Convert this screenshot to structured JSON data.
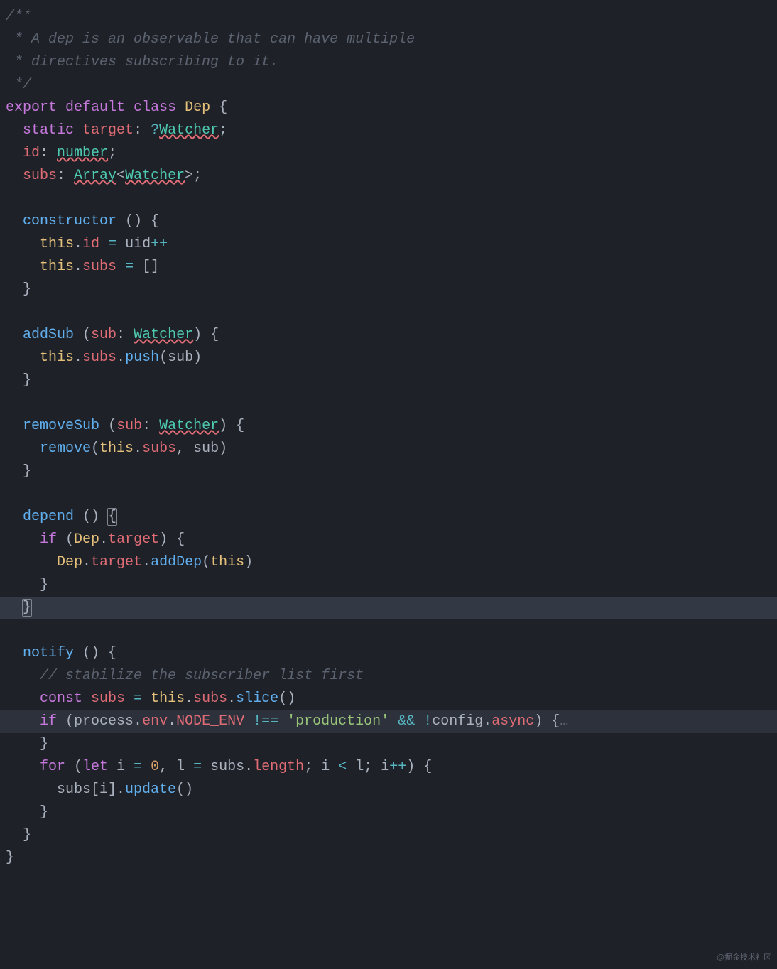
{
  "watermark": "@掘金技术社区",
  "code": {
    "lines": [
      [
        {
          "c": "cm",
          "t": "/**"
        }
      ],
      [
        {
          "c": "cm",
          "t": " * A dep is an observable that can have multiple"
        }
      ],
      [
        {
          "c": "cm",
          "t": " * directives subscribing to it."
        }
      ],
      [
        {
          "c": "cm",
          "t": " */"
        }
      ],
      [
        {
          "c": "kw",
          "t": "export"
        },
        {
          "c": "pn",
          "t": " "
        },
        {
          "c": "kw",
          "t": "default"
        },
        {
          "c": "pn",
          "t": " "
        },
        {
          "c": "kw",
          "t": "class"
        },
        {
          "c": "pn",
          "t": " "
        },
        {
          "c": "cls",
          "t": "Dep"
        },
        {
          "c": "pn",
          "t": " {"
        }
      ],
      [
        {
          "c": "pn",
          "t": "  "
        },
        {
          "c": "kw",
          "t": "static"
        },
        {
          "c": "pn",
          "t": " "
        },
        {
          "c": "var",
          "t": "target"
        },
        {
          "c": "pn",
          "t": ": "
        },
        {
          "c": "op",
          "t": "?"
        },
        {
          "c": "type err",
          "t": "Watcher"
        },
        {
          "c": "pn",
          "t": ";"
        }
      ],
      [
        {
          "c": "pn",
          "t": "  "
        },
        {
          "c": "var",
          "t": "id"
        },
        {
          "c": "pn",
          "t": ": "
        },
        {
          "c": "type err",
          "t": "number"
        },
        {
          "c": "pn",
          "t": ";"
        }
      ],
      [
        {
          "c": "pn",
          "t": "  "
        },
        {
          "c": "var",
          "t": "subs"
        },
        {
          "c": "pn",
          "t": ": "
        },
        {
          "c": "type err",
          "t": "Array"
        },
        {
          "c": "pn",
          "t": "<"
        },
        {
          "c": "type err",
          "t": "Watcher"
        },
        {
          "c": "pn",
          "t": ">;"
        }
      ],
      [
        {
          "c": "pn",
          "t": ""
        }
      ],
      [
        {
          "c": "pn",
          "t": "  "
        },
        {
          "c": "fn",
          "t": "constructor"
        },
        {
          "c": "pn",
          "t": " () {"
        }
      ],
      [
        {
          "c": "pn",
          "t": "    "
        },
        {
          "c": "th",
          "t": "this"
        },
        {
          "c": "pn",
          "t": "."
        },
        {
          "c": "var",
          "t": "id"
        },
        {
          "c": "pn",
          "t": " "
        },
        {
          "c": "op",
          "t": "="
        },
        {
          "c": "pn",
          "t": " uid"
        },
        {
          "c": "op",
          "t": "++"
        }
      ],
      [
        {
          "c": "pn",
          "t": "    "
        },
        {
          "c": "th",
          "t": "this"
        },
        {
          "c": "pn",
          "t": "."
        },
        {
          "c": "var",
          "t": "subs"
        },
        {
          "c": "pn",
          "t": " "
        },
        {
          "c": "op",
          "t": "="
        },
        {
          "c": "pn",
          "t": " []"
        }
      ],
      [
        {
          "c": "pn",
          "t": "  }"
        }
      ],
      [
        {
          "c": "pn",
          "t": ""
        }
      ],
      [
        {
          "c": "pn",
          "t": "  "
        },
        {
          "c": "fn",
          "t": "addSub"
        },
        {
          "c": "pn",
          "t": " ("
        },
        {
          "c": "var",
          "t": "sub"
        },
        {
          "c": "pn",
          "t": ": "
        },
        {
          "c": "type err",
          "t": "Watcher"
        },
        {
          "c": "pn",
          "t": ") {"
        }
      ],
      [
        {
          "c": "pn",
          "t": "    "
        },
        {
          "c": "th",
          "t": "this"
        },
        {
          "c": "pn",
          "t": "."
        },
        {
          "c": "var",
          "t": "subs"
        },
        {
          "c": "pn",
          "t": "."
        },
        {
          "c": "fn",
          "t": "push"
        },
        {
          "c": "pn",
          "t": "(sub)"
        }
      ],
      [
        {
          "c": "pn",
          "t": "  }"
        }
      ],
      [
        {
          "c": "pn",
          "t": ""
        }
      ],
      [
        {
          "c": "pn",
          "t": "  "
        },
        {
          "c": "fn",
          "t": "removeSub"
        },
        {
          "c": "pn",
          "t": " ("
        },
        {
          "c": "var",
          "t": "sub"
        },
        {
          "c": "pn",
          "t": ": "
        },
        {
          "c": "type err",
          "t": "Watcher"
        },
        {
          "c": "pn",
          "t": ") {"
        }
      ],
      [
        {
          "c": "pn",
          "t": "    "
        },
        {
          "c": "fn",
          "t": "remove"
        },
        {
          "c": "pn",
          "t": "("
        },
        {
          "c": "th",
          "t": "this"
        },
        {
          "c": "pn",
          "t": "."
        },
        {
          "c": "var",
          "t": "subs"
        },
        {
          "c": "pn",
          "t": ", sub)"
        }
      ],
      [
        {
          "c": "pn",
          "t": "  }"
        }
      ],
      [
        {
          "c": "pn",
          "t": ""
        }
      ],
      [
        {
          "c": "pn",
          "t": "  "
        },
        {
          "c": "fn",
          "t": "depend"
        },
        {
          "c": "pn",
          "t": " () "
        },
        {
          "c": "pn bracket-highlight",
          "t": "{"
        }
      ],
      [
        {
          "c": "pn",
          "t": "    "
        },
        {
          "c": "kw",
          "t": "if"
        },
        {
          "c": "pn",
          "t": " ("
        },
        {
          "c": "cls",
          "t": "Dep"
        },
        {
          "c": "pn",
          "t": "."
        },
        {
          "c": "var",
          "t": "target"
        },
        {
          "c": "pn",
          "t": ") {"
        }
      ],
      [
        {
          "c": "pn",
          "t": "      "
        },
        {
          "c": "cls",
          "t": "Dep"
        },
        {
          "c": "pn",
          "t": "."
        },
        {
          "c": "var",
          "t": "target"
        },
        {
          "c": "pn",
          "t": "."
        },
        {
          "c": "fn",
          "t": "addDep"
        },
        {
          "c": "pn",
          "t": "("
        },
        {
          "c": "th",
          "t": "this"
        },
        {
          "c": "pn",
          "t": ")"
        }
      ],
      [
        {
          "c": "pn",
          "t": "    }"
        }
      ],
      [
        {
          "c": "pn",
          "t": "  "
        },
        {
          "c": "pn bracket-highlight",
          "t": "}"
        }
      ],
      [
        {
          "c": "pn",
          "t": ""
        }
      ],
      [
        {
          "c": "pn",
          "t": "  "
        },
        {
          "c": "fn",
          "t": "notify"
        },
        {
          "c": "pn",
          "t": " () {"
        }
      ],
      [
        {
          "c": "pn",
          "t": "    "
        },
        {
          "c": "cm",
          "t": "// stabilize the subscriber list first"
        }
      ],
      [
        {
          "c": "pn",
          "t": "    "
        },
        {
          "c": "kw",
          "t": "const"
        },
        {
          "c": "pn",
          "t": " "
        },
        {
          "c": "var",
          "t": "subs"
        },
        {
          "c": "pn",
          "t": " "
        },
        {
          "c": "op",
          "t": "="
        },
        {
          "c": "pn",
          "t": " "
        },
        {
          "c": "th",
          "t": "this"
        },
        {
          "c": "pn",
          "t": "."
        },
        {
          "c": "var",
          "t": "subs"
        },
        {
          "c": "pn",
          "t": "."
        },
        {
          "c": "fn",
          "t": "slice"
        },
        {
          "c": "pn",
          "t": "()"
        }
      ],
      [
        {
          "c": "pn",
          "t": "    "
        },
        {
          "c": "kw",
          "t": "if"
        },
        {
          "c": "pn",
          "t": " (process."
        },
        {
          "c": "var",
          "t": "env"
        },
        {
          "c": "pn",
          "t": "."
        },
        {
          "c": "var",
          "t": "NODE_ENV"
        },
        {
          "c": "pn",
          "t": " "
        },
        {
          "c": "op",
          "t": "!=="
        },
        {
          "c": "pn",
          "t": " "
        },
        {
          "c": "str",
          "t": "'production'"
        },
        {
          "c": "pn",
          "t": " "
        },
        {
          "c": "op",
          "t": "&&"
        },
        {
          "c": "pn",
          "t": " "
        },
        {
          "c": "op",
          "t": "!"
        },
        {
          "c": "pn",
          "t": "config."
        },
        {
          "c": "var",
          "t": "async"
        },
        {
          "c": "pn",
          "t": ") {"
        },
        {
          "c": "fold",
          "t": "…"
        }
      ],
      [
        {
          "c": "pn",
          "t": "    }"
        }
      ],
      [
        {
          "c": "pn",
          "t": "    "
        },
        {
          "c": "kw",
          "t": "for"
        },
        {
          "c": "pn",
          "t": " ("
        },
        {
          "c": "kw",
          "t": "let"
        },
        {
          "c": "pn",
          "t": " i "
        },
        {
          "c": "op",
          "t": "="
        },
        {
          "c": "pn",
          "t": " "
        },
        {
          "c": "num",
          "t": "0"
        },
        {
          "c": "pn",
          "t": ", l "
        },
        {
          "c": "op",
          "t": "="
        },
        {
          "c": "pn",
          "t": " subs."
        },
        {
          "c": "var",
          "t": "length"
        },
        {
          "c": "pn",
          "t": "; i "
        },
        {
          "c": "op",
          "t": "<"
        },
        {
          "c": "pn",
          "t": " l; i"
        },
        {
          "c": "op",
          "t": "++"
        },
        {
          "c": "pn",
          "t": ") {"
        }
      ],
      [
        {
          "c": "pn",
          "t": "      subs[i]."
        },
        {
          "c": "fn",
          "t": "update"
        },
        {
          "c": "pn",
          "t": "()"
        }
      ],
      [
        {
          "c": "pn",
          "t": "    }"
        }
      ],
      [
        {
          "c": "pn",
          "t": "  }"
        }
      ],
      [
        {
          "c": "pn",
          "t": "}"
        }
      ]
    ],
    "highlighted_lines": [
      26,
      31
    ],
    "highlight_light_lines": [
      26
    ]
  }
}
